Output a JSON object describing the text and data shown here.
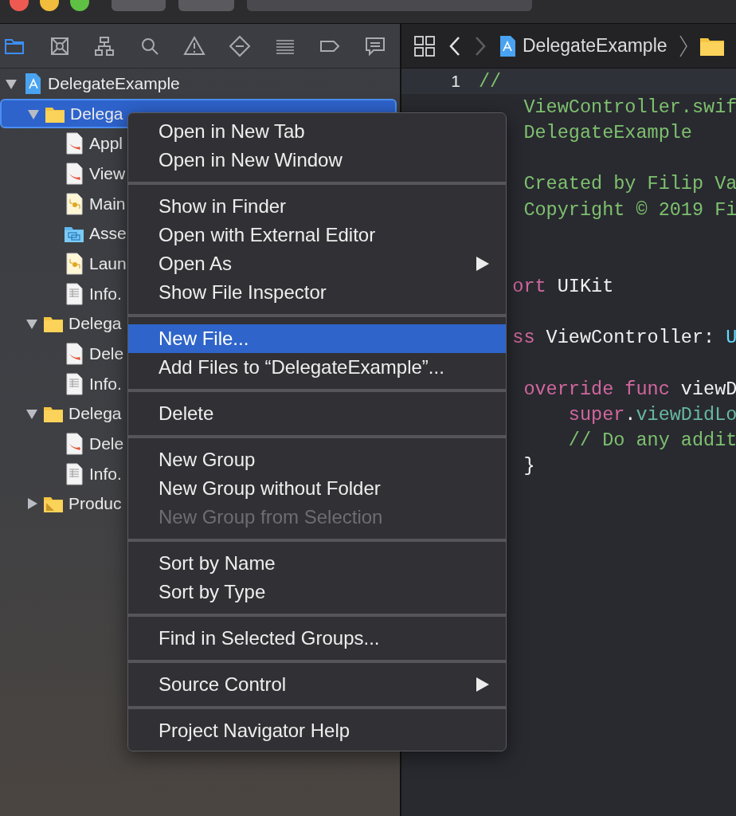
{
  "navigator": {
    "tabs": [
      {
        "kind": "project",
        "selected": true
      },
      {
        "kind": "source-control",
        "selected": false
      },
      {
        "kind": "symbol",
        "selected": false
      },
      {
        "kind": "find",
        "selected": false
      },
      {
        "kind": "issue",
        "selected": false
      },
      {
        "kind": "test",
        "selected": false
      },
      {
        "kind": "debug",
        "selected": false
      },
      {
        "kind": "breakpoint",
        "selected": false
      },
      {
        "kind": "report",
        "selected": false
      }
    ]
  },
  "tree": [
    {
      "label": "DelegateExample",
      "kind": "project",
      "expanded": true,
      "selected": false,
      "children": [
        {
          "label": "Delega",
          "kind": "folder",
          "expanded": true,
          "selected": true,
          "children": [
            {
              "label": "Appl",
              "kind": "swift",
              "selected": false
            },
            {
              "label": "View",
              "kind": "swift",
              "selected": false
            },
            {
              "label": "Main",
              "kind": "storyboard",
              "selected": false
            },
            {
              "label": "Asse",
              "kind": "assets",
              "selected": false
            },
            {
              "label": "Laun",
              "kind": "storyboard",
              "selected": false
            },
            {
              "label": "Info.",
              "kind": "plist",
              "selected": false
            }
          ]
        },
        {
          "label": "Delega",
          "kind": "folder",
          "expanded": true,
          "selected": false,
          "children": [
            {
              "label": "Dele",
              "kind": "swift",
              "selected": false
            },
            {
              "label": "Info.",
              "kind": "plist",
              "selected": false
            }
          ]
        },
        {
          "label": "Delega",
          "kind": "folder",
          "expanded": true,
          "selected": false,
          "children": [
            {
              "label": "Dele",
              "kind": "swift",
              "selected": false
            },
            {
              "label": "Info.",
              "kind": "plist",
              "selected": false
            }
          ]
        },
        {
          "label": "Produc",
          "kind": "products",
          "expanded": false,
          "selected": false
        }
      ]
    }
  ],
  "editor": {
    "forward_disabled": true,
    "breadcrumb": "DelegateExample",
    "lines": [
      {
        "number": "1",
        "current": true,
        "segments": [
          {
            "kind": "comment",
            "text": "//"
          }
        ]
      },
      {
        "segments": [
          {
            "kind": "comment",
            "text": "    ViewController.swif"
          }
        ]
      },
      {
        "segments": [
          {
            "kind": "comment",
            "text": "    DelegateExample"
          }
        ]
      },
      {
        "kind": "blank"
      },
      {
        "segments": [
          {
            "kind": "comment",
            "text": "    Created by Filip Va"
          }
        ]
      },
      {
        "segments": [
          {
            "kind": "comment",
            "text": "    Copyright © 2019 Fi"
          }
        ]
      },
      {
        "kind": "blank"
      },
      {
        "kind": "blank"
      },
      {
        "segments": [
          {
            "kind": "keyword",
            "text": "   ort"
          },
          {
            "kind": "plain",
            "text": " UIKit"
          }
        ]
      },
      {
        "kind": "blank"
      },
      {
        "segments": [
          {
            "kind": "keyword",
            "text": "   ss"
          },
          {
            "kind": "plain",
            "text": " ViewController: "
          },
          {
            "kind": "type",
            "text": "U"
          }
        ]
      },
      {
        "kind": "blank"
      },
      {
        "segments": [
          {
            "kind": "keyword",
            "text": "    override func"
          },
          {
            "kind": "plain",
            "text": " viewD"
          }
        ]
      },
      {
        "segments": [
          {
            "kind": "keyword",
            "text": "        super"
          },
          {
            "kind": "plain",
            "text": "."
          },
          {
            "kind": "method",
            "text": "viewDidLo"
          }
        ]
      },
      {
        "segments": [
          {
            "kind": "comment",
            "text": "        // Do any addit"
          }
        ]
      },
      {
        "segments": [
          {
            "kind": "plain",
            "text": "    }"
          }
        ]
      }
    ]
  },
  "context_menu": {
    "sections": [
      [
        {
          "label": "Open in New Tab",
          "selected": false,
          "disabled": false
        },
        {
          "label": "Open in New Window",
          "selected": false,
          "disabled": false
        }
      ],
      [
        {
          "label": "Show in Finder",
          "selected": false,
          "disabled": false
        },
        {
          "label": "Open with External Editor",
          "selected": false,
          "disabled": false
        },
        {
          "label": "Open As",
          "selected": false,
          "disabled": false,
          "submenu": true
        },
        {
          "label": "Show File Inspector",
          "selected": false,
          "disabled": false
        }
      ],
      [
        {
          "label": "New File...",
          "selected": true,
          "disabled": false
        },
        {
          "label": "Add Files to “DelegateExample”...",
          "selected": false,
          "disabled": false
        }
      ],
      [
        {
          "label": "Delete",
          "selected": false,
          "disabled": false
        }
      ],
      [
        {
          "label": "New Group",
          "selected": false,
          "disabled": false
        },
        {
          "label": "New Group without Folder",
          "selected": false,
          "disabled": false
        },
        {
          "label": "New Group from Selection",
          "selected": false,
          "disabled": true
        }
      ],
      [
        {
          "label": "Sort by Name",
          "selected": false,
          "disabled": false
        },
        {
          "label": "Sort by Type",
          "selected": false,
          "disabled": false
        }
      ],
      [
        {
          "label": "Find in Selected Groups...",
          "selected": false,
          "disabled": false
        }
      ],
      [
        {
          "label": "Source Control",
          "selected": false,
          "disabled": false,
          "submenu": true
        }
      ],
      [
        {
          "label": "Project Navigator Help",
          "selected": false,
          "disabled": false
        }
      ]
    ]
  }
}
